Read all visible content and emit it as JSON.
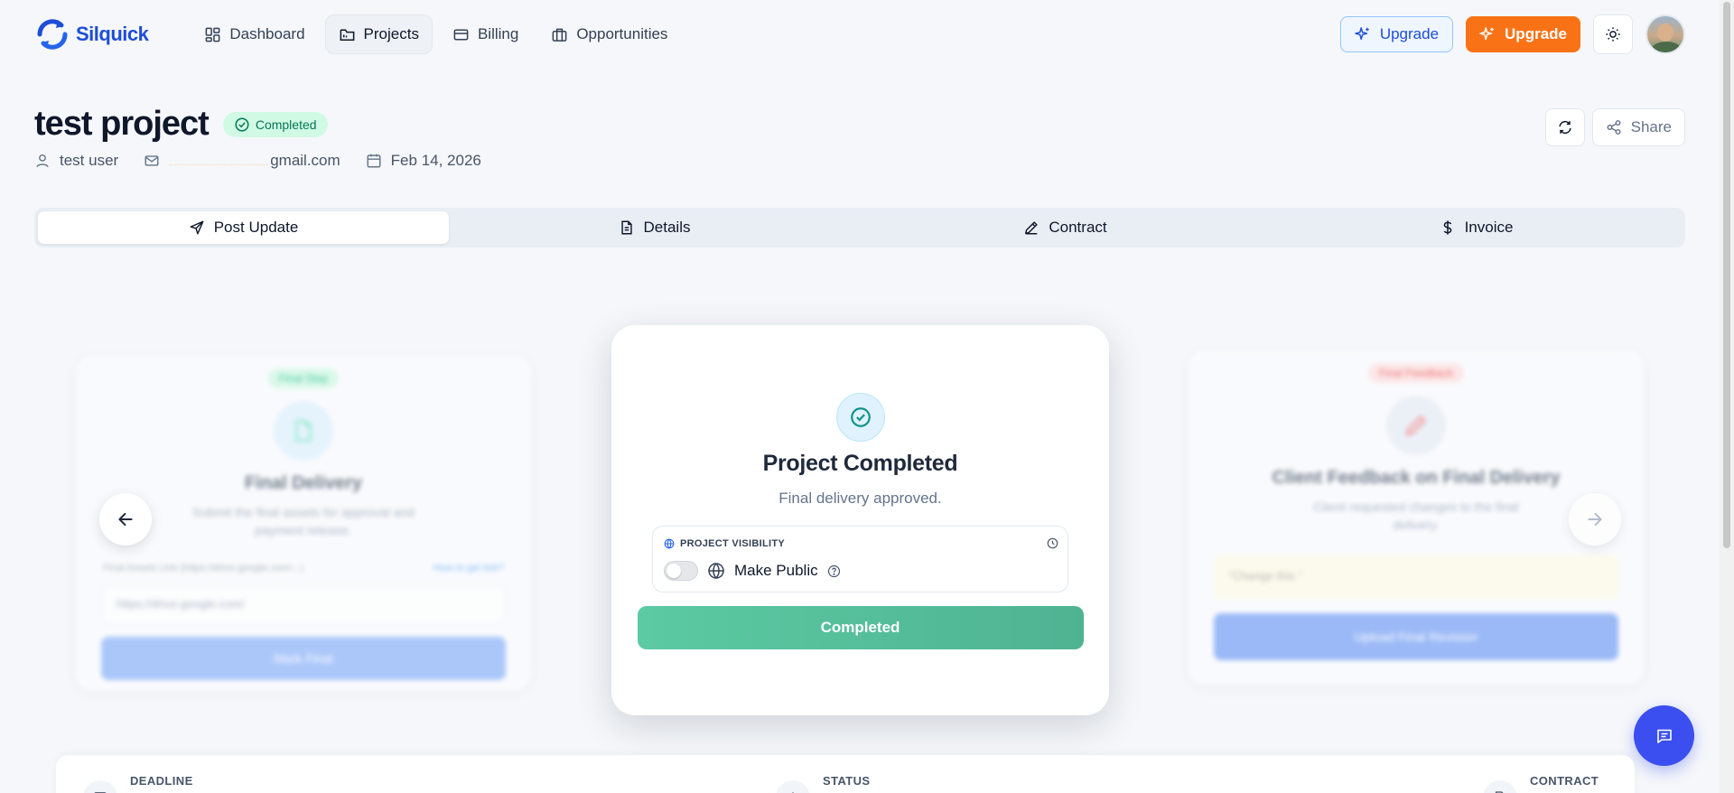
{
  "app": {
    "name": "Silquick",
    "brand_color": "#1d4ed8",
    "accent_orange": "#f97316"
  },
  "nav": {
    "items": [
      {
        "label": "Dashboard",
        "icon": "dashboard-icon"
      },
      {
        "label": "Projects",
        "icon": "folder-icon",
        "active": true
      },
      {
        "label": "Billing",
        "icon": "card-icon"
      },
      {
        "label": "Opportunities",
        "icon": "briefcase-icon"
      }
    ],
    "upgrade_outline_label": "Upgrade",
    "upgrade_fill_label": "Upgrade"
  },
  "project": {
    "title": "test project",
    "status_badge": "Completed",
    "user": "test user",
    "email_visible": "gmail.com",
    "date": "Feb 14, 2026",
    "share_label": "Share"
  },
  "tabs": [
    {
      "label": "Post Update",
      "icon": "send-icon",
      "active": true
    },
    {
      "label": "Details",
      "icon": "document-icon"
    },
    {
      "label": "Contract",
      "icon": "pen-icon"
    },
    {
      "label": "Invoice",
      "icon": "dollar-icon"
    }
  ],
  "carousel": {
    "left_card": {
      "pill": "Final Step",
      "title": "Final Delivery",
      "description": "Submit the final assets for approval and payment release.",
      "link_label": "Final Assets Link (https://drive.google.com/...)",
      "help_link": "How to get link?",
      "input_placeholder": "https://drive.google.com/",
      "button": "Mark Final"
    },
    "main_card": {
      "title": "Project Completed",
      "subtitle": "Final delivery approved.",
      "visibility_label": "PROJECT VISIBILITY",
      "make_public_label": "Make Public",
      "make_public_on": false,
      "button": "Completed"
    },
    "right_card": {
      "pill": "Final Feedback",
      "title": "Client Feedback on Final Delivery",
      "description": "Client requested changes to the final delivery.",
      "feedback_text": "\"Change this \"",
      "button": "Upload Final Revision"
    }
  },
  "info_strip": {
    "deadline_label": "DEADLINE",
    "status_label": "STATUS",
    "contract_label": "CONTRACT"
  }
}
